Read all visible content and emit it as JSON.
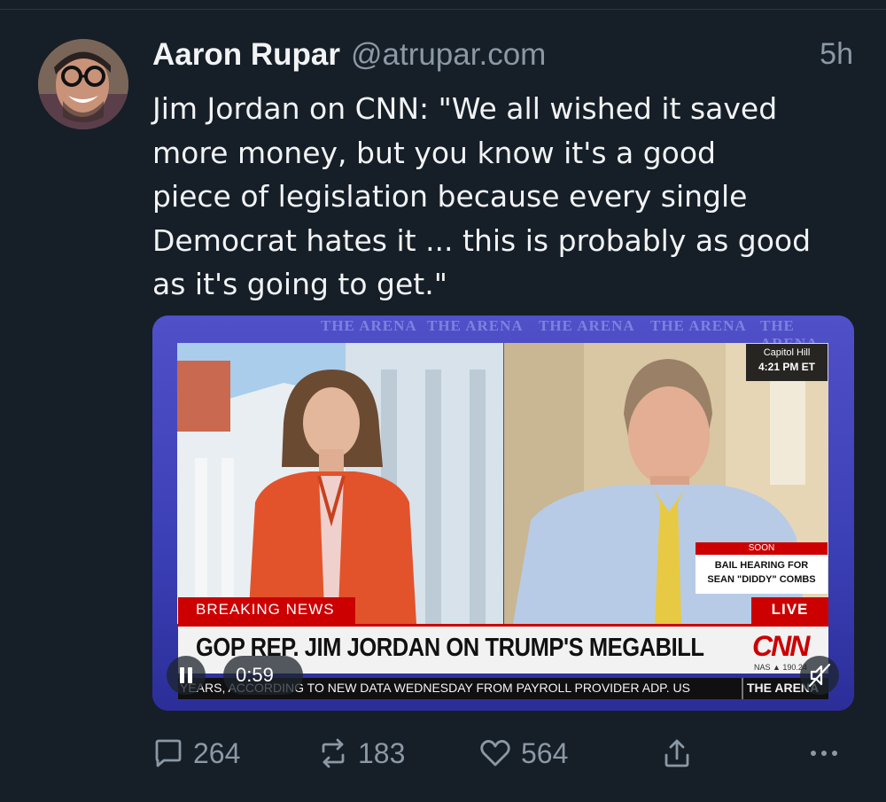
{
  "post": {
    "author_name": "Aaron Rupar",
    "author_handle": "@atrupar.com",
    "time_ago": "5h",
    "text_lines": [
      "Jim Jordan on CNN: \"We all wished it saved",
      "more money, but you know it's a good",
      "piece of legislation because every single",
      "Democrat hates it ... this is probably as good",
      "as it's going to get.\""
    ]
  },
  "video": {
    "backdrop_text": "THE ARENA",
    "location": "Capitol Hill",
    "clock": "4:21 PM ET",
    "soon_label": "SOON",
    "soon_line1": "BAIL HEARING FOR",
    "soon_line2": "SEAN \"DIDDY\" COMBS",
    "breaking_label": "BREAKING NEWS",
    "live_label": "LIVE",
    "headline": "GOP REP. JIM JORDAN ON TRUMP'S MEGABILL",
    "network_logo": "CNN",
    "market": "NAS ▲ 190.24",
    "ticker_text": "YEARS, ACCORDING TO NEW DATA WEDNESDAY FROM PAYROLL PROVIDER ADP. US",
    "ticker_show": "THE ARENA",
    "timecode": "0:59"
  },
  "actions": {
    "replies": "264",
    "reposts": "183",
    "likes": "564"
  },
  "icons": [
    "reply-icon",
    "repost-icon",
    "like-icon",
    "share-icon",
    "more-icon",
    "pause-icon",
    "mute-icon"
  ]
}
